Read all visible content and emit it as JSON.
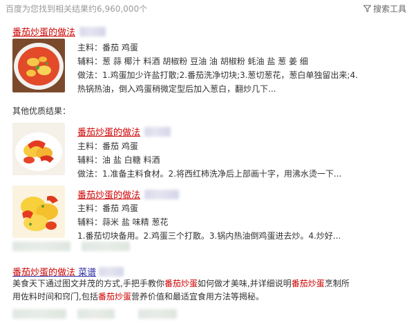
{
  "header": {
    "result_count": "百度为您找到相关结果约6,960,000个",
    "tools_label": "搜索工具"
  },
  "top_result": {
    "title": "番茄炒蛋的做法",
    "main_ing": "主料：番茄 鸡蛋",
    "aux_ing": "辅料：葱 蒜 椰汁 料酒 胡椒粉 豆油 油 胡椒粉 蚝油 盐 葱 姜 细",
    "steps_1": "做法：1.鸡蛋加少许盐打散;2.番茄洗净切块;3.葱切葱花，葱白单独留出来;4.",
    "steps_2": "热锅热油，倒入鸡蛋稍微定型后加入葱白，翻炒几下..."
  },
  "other_label": "其他优质结果：",
  "others": [
    {
      "title": "番茄炒蛋的做法",
      "main_ing": "主料：番茄 鸡蛋",
      "aux_ing": "辅料：油 盐 白糖 料酒",
      "steps": "做法：1.准备主料食材。2.将西红柿洗净后上部画十字，用沸水烫一下..."
    },
    {
      "title": "番茄炒蛋的做法",
      "main_ing": "主料：番茄 鸡蛋",
      "aux_ing": "辅料：蒜米 盐 味精 葱花",
      "steps": "1.番茄切块备用。2.鸡蛋三个打散。3.锅内热油倒鸡蛋进去炒。4.炒好..."
    }
  ],
  "last_result": {
    "title": "番茄炒蛋的做法",
    "title_suffix": "菜谱",
    "snippet_a": "美食天下通过图文并茂的方式,手把手教你",
    "snippet_hl1": "番茄炒蛋",
    "snippet_b": "如何做才美味,并详细说明",
    "snippet_hl2": "番茄炒蛋",
    "snippet_c": "烹制所",
    "snippet_d": "用佐料时间和窍门,包括",
    "snippet_hl3": "番茄炒蛋",
    "snippet_e": "营养价值和最适宜食用方法等揭秘。"
  },
  "colors": {
    "link": "#2a2aa5",
    "highlight": "#cc0000",
    "text": "#333333",
    "muted": "#999999"
  }
}
